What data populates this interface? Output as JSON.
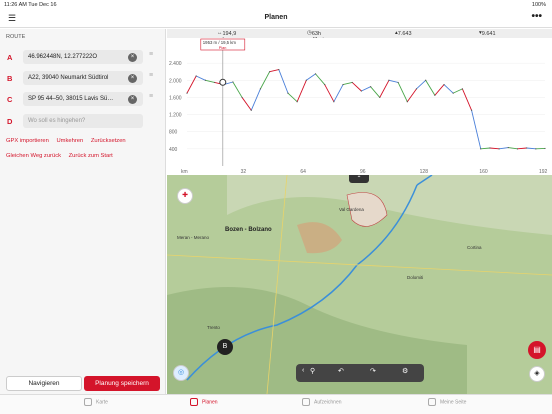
{
  "status": {
    "time": "11:26 AM",
    "date": "Tue Dec 16",
    "battery": "100%"
  },
  "nav": {
    "title": "Planen"
  },
  "route": {
    "label": "ROUTE",
    "waypoints": [
      {
        "letter": "A",
        "value": "46.962448N, 12.277222O",
        "placeholder": ""
      },
      {
        "letter": "B",
        "value": "A22, 39040 Neumarkt Südtirol",
        "placeholder": ""
      },
      {
        "letter": "C",
        "value": "SP 95 44–50, 38015 Lavis Sü…",
        "placeholder": ""
      },
      {
        "letter": "D",
        "value": "",
        "placeholder": "Wo soll es hingehen?"
      }
    ],
    "actions_row1": [
      "GPX importieren",
      "Umkehren",
      "Zurücksetzen"
    ],
    "actions_row2": [
      "Gleichen Weg zurück",
      "Zurück zum Start"
    ]
  },
  "buttons": {
    "navigate": "Navigieren",
    "save": "Planung speichern"
  },
  "tabs": [
    "Karte",
    "Planen",
    "Aufzeichnen",
    "Meine Seite"
  ],
  "stats": {
    "distance": "194,9 km",
    "duration": "63h 41min",
    "ascent": "7.643 m",
    "descent": "9.641 m"
  },
  "colors": {
    "accent": "#d4142a"
  },
  "chart_data": {
    "type": "line",
    "x_ticks": [
      "km",
      "32",
      "64",
      "96",
      "128",
      "160",
      "192"
    ],
    "y_ticks": [
      2400,
      2000,
      1600,
      1200,
      800,
      400
    ],
    "tooltip": "1953 m / 19,5 km",
    "tooltip_sub": "Plan",
    "x": [
      0,
      5,
      10,
      15,
      20,
      25,
      30,
      35,
      40,
      45,
      50,
      55,
      60,
      65,
      70,
      75,
      80,
      85,
      90,
      95,
      100,
      105,
      110,
      115,
      120,
      125,
      130,
      135,
      140,
      145,
      150,
      155,
      160,
      165,
      170,
      175,
      180,
      185,
      190,
      195
    ],
    "y": [
      1700,
      2100,
      2000,
      1950,
      1900,
      1960,
      1600,
      1300,
      1800,
      2200,
      2250,
      1700,
      1500,
      2000,
      2150,
      1900,
      1500,
      1900,
      1950,
      1750,
      1850,
      1600,
      2000,
      1950,
      1500,
      1800,
      2000,
      1650,
      1900,
      1700,
      1800,
      1300,
      400,
      420,
      400,
      430,
      400,
      420,
      400,
      410
    ],
    "ylim": [
      0,
      2800
    ],
    "xlim": [
      0,
      195
    ]
  },
  "map": {
    "labels": [
      {
        "text": "Bozen - Bolzano",
        "size": "big"
      },
      {
        "text": "Meran - Merano",
        "size": "small"
      },
      {
        "text": "Val Gardena",
        "size": "small"
      },
      {
        "text": "Cortina",
        "size": "small"
      },
      {
        "text": "Trento",
        "size": "small"
      },
      {
        "text": "Dolomiti",
        "size": "small"
      }
    ],
    "marker": "B",
    "zoom_badge": "B"
  }
}
